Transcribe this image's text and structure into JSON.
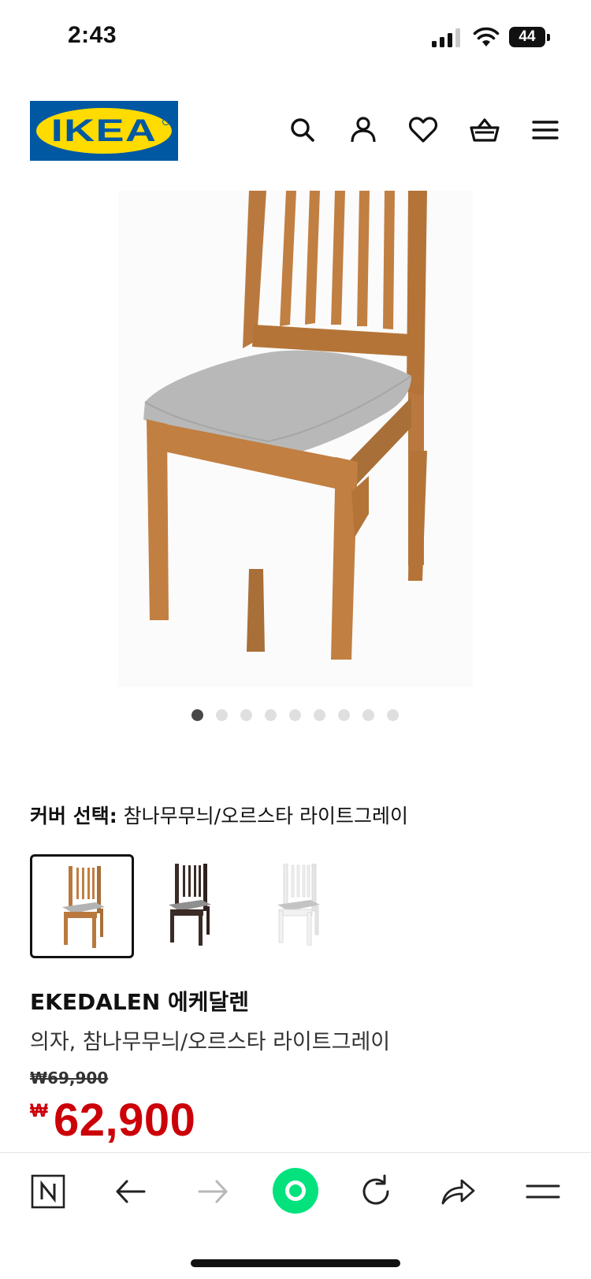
{
  "status_bar": {
    "time": "2:43",
    "battery": "44"
  },
  "header": {
    "logo_text": "IKEA",
    "icons": [
      "search-icon",
      "account-icon",
      "heart-icon",
      "cart-icon",
      "menu-icon"
    ]
  },
  "gallery": {
    "dot_count": 9,
    "active_index": 0
  },
  "cover_selection": {
    "label": "커버 선택:",
    "value": "참나무무늬/오르스타 라이트그레이",
    "swatches": [
      {
        "name": "oak-light-grey",
        "frame": "#b9793e",
        "seat": "#b3b3b3",
        "selected": true
      },
      {
        "name": "dark-brown-grey",
        "frame": "#3a2b27",
        "seat": "#8f8f8f",
        "selected": false
      },
      {
        "name": "white-light-grey",
        "frame": "#f2f2f2",
        "seat": "#c4c4c4",
        "selected": false
      }
    ]
  },
  "product": {
    "name": "EKEDALEN 에케달렌",
    "description": "의자, 참나무무늬/오르스타 라이트그레이",
    "old_price": "₩69,900",
    "currency": "₩",
    "price": "62,900"
  },
  "colors": {
    "ikea_blue": "#0058a3",
    "ikea_yellow": "#ffdb00",
    "price_red": "#cc0008",
    "naver_green": "#03e27c"
  },
  "browser_bar": {
    "icons": [
      "naver-n-icon",
      "back-arrow-icon",
      "forward-arrow-icon",
      "green-dot-icon",
      "reload-icon",
      "share-icon",
      "menu-lines-icon"
    ]
  }
}
